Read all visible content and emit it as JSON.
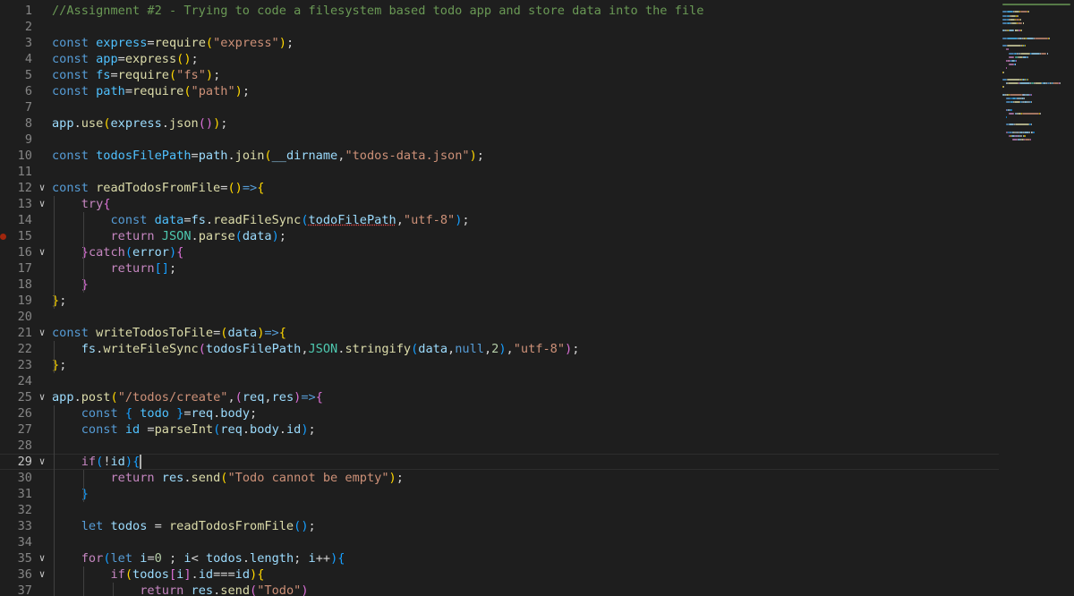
{
  "editor": {
    "active_line": 29,
    "breakpoint_line": 15,
    "lines": [
      {
        "n": 1,
        "fold": false,
        "tokens": [
          [
            "//Assignment #2 - Trying to code a filesystem based todo app and store data into the file",
            "cm"
          ]
        ]
      },
      {
        "n": 2,
        "fold": false,
        "tokens": []
      },
      {
        "n": 3,
        "fold": false,
        "tokens": [
          [
            "const ",
            "k"
          ],
          [
            "express",
            "c"
          ],
          [
            "=",
            "p"
          ],
          [
            "require",
            "f"
          ],
          [
            "(",
            "b1"
          ],
          [
            "\"express\"",
            "s"
          ],
          [
            ")",
            "b1"
          ],
          [
            ";",
            "p"
          ]
        ]
      },
      {
        "n": 4,
        "fold": false,
        "tokens": [
          [
            "const ",
            "k"
          ],
          [
            "app",
            "c"
          ],
          [
            "=",
            "p"
          ],
          [
            "express",
            "f"
          ],
          [
            "(",
            "b1"
          ],
          [
            ")",
            "b1"
          ],
          [
            ";",
            "p"
          ]
        ]
      },
      {
        "n": 5,
        "fold": false,
        "tokens": [
          [
            "const ",
            "k"
          ],
          [
            "fs",
            "c"
          ],
          [
            "=",
            "p"
          ],
          [
            "require",
            "f"
          ],
          [
            "(",
            "b1"
          ],
          [
            "\"fs\"",
            "s"
          ],
          [
            ")",
            "b1"
          ],
          [
            ";",
            "p"
          ]
        ]
      },
      {
        "n": 6,
        "fold": false,
        "tokens": [
          [
            "const ",
            "k"
          ],
          [
            "path",
            "c"
          ],
          [
            "=",
            "p"
          ],
          [
            "require",
            "f"
          ],
          [
            "(",
            "b1"
          ],
          [
            "\"path\"",
            "s"
          ],
          [
            ")",
            "b1"
          ],
          [
            ";",
            "p"
          ]
        ]
      },
      {
        "n": 7,
        "fold": false,
        "tokens": []
      },
      {
        "n": 8,
        "fold": false,
        "tokens": [
          [
            "app",
            "v"
          ],
          [
            ".",
            "p"
          ],
          [
            "use",
            "f"
          ],
          [
            "(",
            "b1"
          ],
          [
            "express",
            "v"
          ],
          [
            ".",
            "p"
          ],
          [
            "json",
            "f"
          ],
          [
            "(",
            "b2"
          ],
          [
            ")",
            "b2"
          ],
          [
            ")",
            "b1"
          ],
          [
            ";",
            "p"
          ]
        ]
      },
      {
        "n": 9,
        "fold": false,
        "tokens": []
      },
      {
        "n": 10,
        "fold": false,
        "tokens": [
          [
            "const ",
            "k"
          ],
          [
            "todosFilePath",
            "c"
          ],
          [
            "=",
            "p"
          ],
          [
            "path",
            "v"
          ],
          [
            ".",
            "p"
          ],
          [
            "join",
            "f"
          ],
          [
            "(",
            "b1"
          ],
          [
            "__dirname",
            "v"
          ],
          [
            ",",
            "p"
          ],
          [
            "\"todos-data.json\"",
            "s"
          ],
          [
            ")",
            "b1"
          ],
          [
            ";",
            "p"
          ]
        ]
      },
      {
        "n": 11,
        "fold": false,
        "tokens": []
      },
      {
        "n": 12,
        "fold": true,
        "tokens": [
          [
            "const ",
            "k"
          ],
          [
            "readTodosFromFile",
            "f"
          ],
          [
            "=",
            "p"
          ],
          [
            "(",
            "b1"
          ],
          [
            ")",
            "b1"
          ],
          [
            "=>",
            "k"
          ],
          [
            "{",
            "b1"
          ]
        ]
      },
      {
        "n": 13,
        "fold": true,
        "tokens": [
          [
            "    ",
            "p"
          ],
          [
            "try",
            "ctl"
          ],
          [
            "{",
            "b2"
          ]
        ]
      },
      {
        "n": 14,
        "fold": false,
        "tokens": [
          [
            "        ",
            "p"
          ],
          [
            "const ",
            "k"
          ],
          [
            "data",
            "c"
          ],
          [
            "=",
            "p"
          ],
          [
            "fs",
            "v"
          ],
          [
            ".",
            "p"
          ],
          [
            "readFileSync",
            "f"
          ],
          [
            "(",
            "b3"
          ],
          [
            "todoFilePath",
            "v"
          ],
          [
            ",",
            "p"
          ],
          [
            "\"utf-8\"",
            "s"
          ],
          [
            ")",
            "b3"
          ],
          [
            ";",
            "p"
          ]
        ]
      },
      {
        "n": 15,
        "fold": false,
        "tokens": [
          [
            "        ",
            "p"
          ],
          [
            "return ",
            "ctl"
          ],
          [
            "JSON",
            "ty"
          ],
          [
            ".",
            "p"
          ],
          [
            "parse",
            "f"
          ],
          [
            "(",
            "b3"
          ],
          [
            "data",
            "v"
          ],
          [
            ")",
            "b3"
          ],
          [
            ";",
            "p"
          ]
        ]
      },
      {
        "n": 16,
        "fold": true,
        "tokens": [
          [
            "    ",
            "p"
          ],
          [
            "}",
            "b2"
          ],
          [
            "catch",
            "ctl"
          ],
          [
            "(",
            "b3"
          ],
          [
            "error",
            "v"
          ],
          [
            ")",
            "b3"
          ],
          [
            "{",
            "b2"
          ]
        ]
      },
      {
        "n": 17,
        "fold": false,
        "tokens": [
          [
            "        ",
            "p"
          ],
          [
            "return",
            "ctl"
          ],
          [
            "[",
            "b3"
          ],
          [
            "]",
            "b3"
          ],
          [
            ";",
            "p"
          ]
        ]
      },
      {
        "n": 18,
        "fold": false,
        "tokens": [
          [
            "    ",
            "p"
          ],
          [
            "}",
            "b2"
          ]
        ]
      },
      {
        "n": 19,
        "fold": false,
        "tokens": [
          [
            "}",
            "b1"
          ],
          [
            ";",
            "p"
          ]
        ]
      },
      {
        "n": 20,
        "fold": false,
        "tokens": []
      },
      {
        "n": 21,
        "fold": true,
        "tokens": [
          [
            "const ",
            "k"
          ],
          [
            "writeTodosToFile",
            "f"
          ],
          [
            "=",
            "p"
          ],
          [
            "(",
            "b1"
          ],
          [
            "data",
            "v"
          ],
          [
            ")",
            "b1"
          ],
          [
            "=>",
            "k"
          ],
          [
            "{",
            "b1"
          ]
        ]
      },
      {
        "n": 22,
        "fold": false,
        "tokens": [
          [
            "    ",
            "p"
          ],
          [
            "fs",
            "v"
          ],
          [
            ".",
            "p"
          ],
          [
            "writeFileSync",
            "f"
          ],
          [
            "(",
            "b2"
          ],
          [
            "todosFilePath",
            "v"
          ],
          [
            ",",
            "p"
          ],
          [
            "JSON",
            "ty"
          ],
          [
            ".",
            "p"
          ],
          [
            "stringify",
            "f"
          ],
          [
            "(",
            "b3"
          ],
          [
            "data",
            "v"
          ],
          [
            ",",
            "p"
          ],
          [
            "null",
            "k"
          ],
          [
            ",",
            "p"
          ],
          [
            "2",
            "n"
          ],
          [
            ")",
            "b3"
          ],
          [
            ",",
            "p"
          ],
          [
            "\"utf-8\"",
            "s"
          ],
          [
            ")",
            "b2"
          ],
          [
            ";",
            "p"
          ]
        ]
      },
      {
        "n": 23,
        "fold": false,
        "tokens": [
          [
            "}",
            "b1"
          ],
          [
            ";",
            "p"
          ]
        ]
      },
      {
        "n": 24,
        "fold": false,
        "tokens": []
      },
      {
        "n": 25,
        "fold": true,
        "tokens": [
          [
            "app",
            "v"
          ],
          [
            ".",
            "p"
          ],
          [
            "post",
            "f"
          ],
          [
            "(",
            "b1"
          ],
          [
            "\"/todos/create\"",
            "s"
          ],
          [
            ",",
            "p"
          ],
          [
            "(",
            "b2"
          ],
          [
            "req",
            "v"
          ],
          [
            ",",
            "p"
          ],
          [
            "res",
            "v"
          ],
          [
            ")",
            "b2"
          ],
          [
            "=>",
            "k"
          ],
          [
            "{",
            "b2"
          ]
        ]
      },
      {
        "n": 26,
        "fold": false,
        "tokens": [
          [
            "    ",
            "p"
          ],
          [
            "const ",
            "k"
          ],
          [
            "{ ",
            "b3"
          ],
          [
            "todo ",
            "c"
          ],
          [
            "}",
            "b3"
          ],
          [
            "=",
            "p"
          ],
          [
            "req",
            "v"
          ],
          [
            ".",
            "p"
          ],
          [
            "body",
            "v"
          ],
          [
            ";",
            "p"
          ]
        ]
      },
      {
        "n": 27,
        "fold": false,
        "tokens": [
          [
            "    ",
            "p"
          ],
          [
            "const ",
            "k"
          ],
          [
            "id ",
            "c"
          ],
          [
            "=",
            "p"
          ],
          [
            "parseInt",
            "f"
          ],
          [
            "(",
            "b3"
          ],
          [
            "req",
            "v"
          ],
          [
            ".",
            "p"
          ],
          [
            "body",
            "v"
          ],
          [
            ".",
            "p"
          ],
          [
            "id",
            "v"
          ],
          [
            ")",
            "b3"
          ],
          [
            ";",
            "p"
          ]
        ]
      },
      {
        "n": 28,
        "fold": false,
        "tokens": []
      },
      {
        "n": 29,
        "fold": true,
        "tokens": [
          [
            "    ",
            "p"
          ],
          [
            "if",
            "ctl"
          ],
          [
            "(",
            "b3"
          ],
          [
            "!",
            "p"
          ],
          [
            "id",
            "v"
          ],
          [
            ")",
            "b3"
          ],
          [
            "{",
            "b3"
          ]
        ]
      },
      {
        "n": 30,
        "fold": false,
        "tokens": [
          [
            "        ",
            "p"
          ],
          [
            "return ",
            "ctl"
          ],
          [
            "res",
            "v"
          ],
          [
            ".",
            "p"
          ],
          [
            "send",
            "f"
          ],
          [
            "(",
            "b1"
          ],
          [
            "\"Todo cannot be empty\"",
            "s"
          ],
          [
            ")",
            "b1"
          ],
          [
            ";",
            "p"
          ]
        ]
      },
      {
        "n": 31,
        "fold": false,
        "tokens": [
          [
            "    ",
            "p"
          ],
          [
            "}",
            "b3"
          ]
        ]
      },
      {
        "n": 32,
        "fold": false,
        "tokens": []
      },
      {
        "n": 33,
        "fold": false,
        "tokens": [
          [
            "    ",
            "p"
          ],
          [
            "let ",
            "k"
          ],
          [
            "todos ",
            "v"
          ],
          [
            "= ",
            "p"
          ],
          [
            "readTodosFromFile",
            "f"
          ],
          [
            "(",
            "b3"
          ],
          [
            ")",
            "b3"
          ],
          [
            ";",
            "p"
          ]
        ]
      },
      {
        "n": 34,
        "fold": false,
        "tokens": []
      },
      {
        "n": 35,
        "fold": true,
        "tokens": [
          [
            "    ",
            "p"
          ],
          [
            "for",
            "ctl"
          ],
          [
            "(",
            "b3"
          ],
          [
            "let ",
            "k"
          ],
          [
            "i",
            "v"
          ],
          [
            "=",
            "p"
          ],
          [
            "0",
            "n"
          ],
          [
            " ; ",
            "p"
          ],
          [
            "i",
            "v"
          ],
          [
            "< ",
            "p"
          ],
          [
            "todos",
            "v"
          ],
          [
            ".",
            "p"
          ],
          [
            "length",
            "v"
          ],
          [
            "; ",
            "p"
          ],
          [
            "i",
            "v"
          ],
          [
            "++",
            "p"
          ],
          [
            ")",
            "b3"
          ],
          [
            "{",
            "b3"
          ]
        ]
      },
      {
        "n": 36,
        "fold": true,
        "tokens": [
          [
            "        ",
            "p"
          ],
          [
            "if",
            "ctl"
          ],
          [
            "(",
            "b1"
          ],
          [
            "todos",
            "v"
          ],
          [
            "[",
            "b2"
          ],
          [
            "i",
            "v"
          ],
          [
            "]",
            "b2"
          ],
          [
            ".",
            "p"
          ],
          [
            "id",
            "v"
          ],
          [
            "===",
            "p"
          ],
          [
            "id",
            "v"
          ],
          [
            ")",
            "b1"
          ],
          [
            "{",
            "b1"
          ]
        ]
      },
      {
        "n": 37,
        "fold": false,
        "tokens": [
          [
            "            ",
            "p"
          ],
          [
            "return ",
            "ctl"
          ],
          [
            "res",
            "v"
          ],
          [
            ".",
            "p"
          ],
          [
            "send",
            "f"
          ],
          [
            "(",
            "b2"
          ],
          [
            "\"Todo\"",
            "s"
          ],
          [
            ")",
            "b2"
          ]
        ]
      }
    ]
  },
  "icons": {
    "fold": "chevron-down-icon",
    "breakpoint": "breakpoint-dot-icon"
  },
  "colors": {
    "background": "#1e1e1e",
    "keyword": "#569cd6",
    "control": "#c586c0",
    "string": "#ce9178",
    "function": "#dcdcaa",
    "comment": "#6a9955",
    "breakpoint": "#a1260d"
  }
}
